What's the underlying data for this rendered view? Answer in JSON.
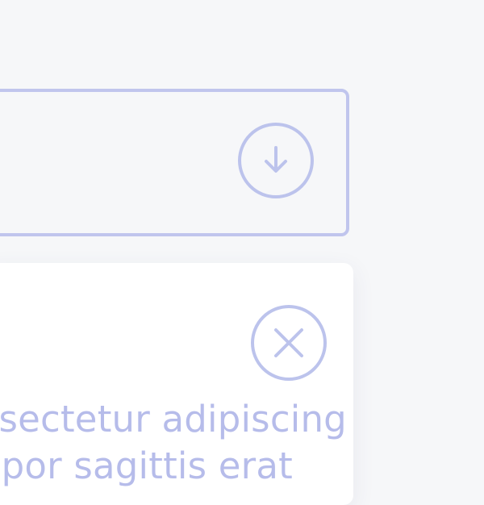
{
  "download_card": {
    "icon": "download-arrow-icon"
  },
  "message_card": {
    "close_icon": "close-x-icon",
    "text_lines": [
      "Lorem ipsum dolor sit amet, consectetur adipiscing elit. Fusce",
      "quis ante nec nisl viverra tempor sagittis erat"
    ]
  },
  "colors": {
    "accent": "#bcc3ec",
    "background": "#f6f7f9",
    "card": "#ffffff",
    "text": "#b6bcea"
  }
}
